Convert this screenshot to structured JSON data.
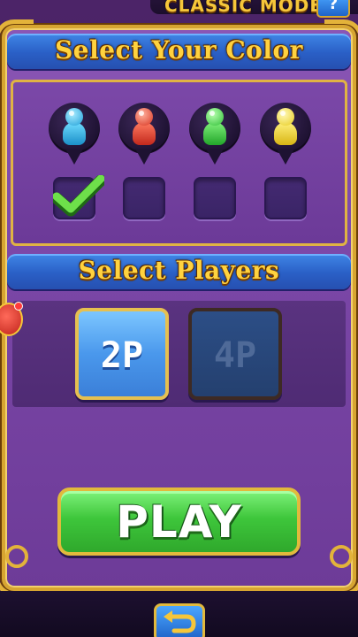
{
  "header": {
    "mode_label": "CLASSIC MODE",
    "info_label": "?"
  },
  "color_section": {
    "title": "Select Your Color",
    "colors": [
      {
        "name": "blue",
        "hex": "#2fb8e8",
        "selected": true
      },
      {
        "name": "red",
        "hex": "#e8412f",
        "selected": false
      },
      {
        "name": "green",
        "hex": "#3fd24a",
        "selected": false
      },
      {
        "name": "yellow",
        "hex": "#f5dc2a",
        "selected": false
      }
    ]
  },
  "players_section": {
    "title": "Select Players",
    "options": [
      {
        "label": "2P",
        "active": true
      },
      {
        "label": "4P",
        "active": false
      }
    ]
  },
  "play_button": {
    "label": "PLAY"
  },
  "footer": {
    "back_icon": "return-arrow-icon"
  },
  "colors": {
    "panel": "#7a46a6",
    "border_gold": "#d7a531",
    "banner_blue": "#2a5fc6",
    "title_yellow": "#ffd23f",
    "play_green": "#3ec63b"
  }
}
